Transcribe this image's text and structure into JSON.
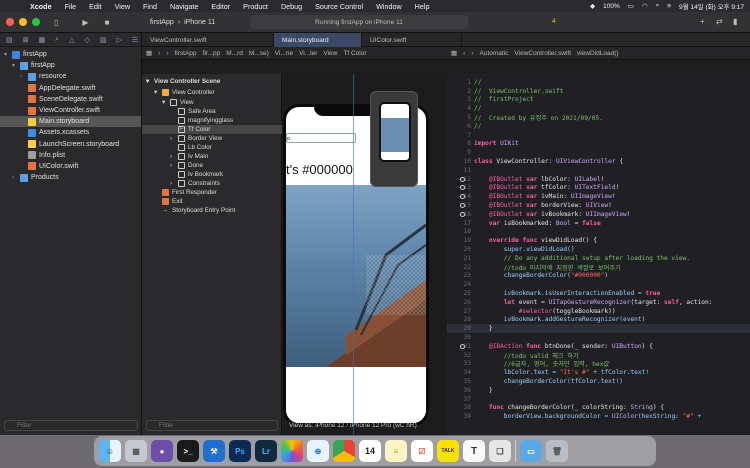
{
  "menubar": {
    "app_name": "Xcode",
    "items": [
      "File",
      "Edit",
      "View",
      "Find",
      "Navigate",
      "Editor",
      "Product",
      "Debug",
      "Source Control",
      "Window",
      "Help"
    ],
    "battery": "100%",
    "datetime": "9월 14일 (화) 오후 9:17"
  },
  "toolbar": {
    "scheme_name": "firstApp",
    "device_name": "iPhone 11",
    "status": "Running firstApp on iPhone 11",
    "warning_count": "4"
  },
  "tabs": [
    {
      "label": "ViewController.swift",
      "active": false
    },
    {
      "label": "Main.storyboard",
      "active": true
    },
    {
      "label": "UIColor.swift",
      "active": false
    }
  ],
  "navigator": {
    "project": "firstApp",
    "items": [
      {
        "label": "firstApp",
        "kind": "folder",
        "depth": 1
      },
      {
        "label": "resource",
        "kind": "folder",
        "depth": 2
      },
      {
        "label": "AppDelegate.swift",
        "kind": "swift",
        "depth": 2
      },
      {
        "label": "SceneDelegate.swift",
        "kind": "swift",
        "depth": 2
      },
      {
        "label": "ViewController.swift",
        "kind": "swift",
        "depth": 2
      },
      {
        "label": "Main.storyboard",
        "kind": "storyboard",
        "depth": 2,
        "selected": true
      },
      {
        "label": "Assets.xcassets",
        "kind": "assets",
        "depth": 2
      },
      {
        "label": "LaunchScreen.storyboard",
        "kind": "storyboard",
        "depth": 2
      },
      {
        "label": "Info.plist",
        "kind": "plist",
        "depth": 2
      },
      {
        "label": "UIColor.swift",
        "kind": "swift",
        "depth": 2
      },
      {
        "label": "Products",
        "kind": "folder",
        "depth": 1
      }
    ],
    "filter_placeholder": "Filter"
  },
  "storyboard_path": [
    "firstApp",
    "fir...pp",
    "M...rd",
    "M...se)",
    "Vi...ne",
    "Vi...ler",
    "View",
    "Tf Color"
  ],
  "code_path": [
    "Automatic",
    "ViewController.swift",
    "viewDidLoad()"
  ],
  "outline": {
    "rows": [
      {
        "label": "View Controller Scene",
        "bold": true
      },
      {
        "label": "View Controller"
      },
      {
        "label": "View"
      },
      {
        "label": "Safe Area"
      },
      {
        "label": "magnifyingglass"
      },
      {
        "label": "Tf Color",
        "selected": true
      },
      {
        "label": "Border View"
      },
      {
        "label": "Lb Color"
      },
      {
        "label": "Iv Main"
      },
      {
        "label": "Done"
      },
      {
        "label": "Iv Bookmark"
      },
      {
        "label": "Constraints"
      },
      {
        "label": "First Responder"
      },
      {
        "label": "Exit"
      },
      {
        "label": "Storyboard Entry Point"
      }
    ],
    "filter_placeholder": "Filter"
  },
  "canvas": {
    "label_text": "t's #000000",
    "view_as": "View as: iPhone 12 / iPhone 12 Pro (wC hR)"
  },
  "code": {
    "start_line": 1,
    "highlight_line": 29,
    "lines": [
      {
        "n": "1",
        "t": "//",
        "c": "comment"
      },
      {
        "n": "2",
        "t": "//  ViewController.swift",
        "c": "comment"
      },
      {
        "n": "3",
        "t": "//  firstProject",
        "c": "comment"
      },
      {
        "n": "4",
        "t": "//",
        "c": "comment"
      },
      {
        "n": "5",
        "t": "//  Created by 유정주 on 2021/09/05.",
        "c": "comment"
      },
      {
        "n": "6",
        "t": "//",
        "c": "comment"
      },
      {
        "n": "7",
        "t": "",
        "c": "plain"
      },
      {
        "n": "8",
        "t": "import UIKit",
        "c": "kw"
      },
      {
        "n": "9",
        "t": "",
        "c": "plain"
      },
      {
        "n": "10",
        "t": "class ViewController: UIViewController {",
        "c": "kw"
      },
      {
        "n": "11",
        "t": "",
        "c": "plain"
      },
      {
        "n": "12",
        "t": "    @IBOutlet var lbColor: UILabel!",
        "c": "outlet",
        "marker": true
      },
      {
        "n": "13",
        "t": "    @IBOutlet var tfColor: UITextField!",
        "c": "outlet",
        "marker": true
      },
      {
        "n": "14",
        "t": "    @IBOutlet var ivMain: UIImageView!",
        "c": "outlet",
        "marker": true
      },
      {
        "n": "15",
        "t": "    @IBOutlet var borderView: UIView!",
        "c": "outlet",
        "marker": true
      },
      {
        "n": "16",
        "t": "    @IBOutlet var ivBookmark: UIImageView!",
        "c": "outlet",
        "marker": true
      },
      {
        "n": "17",
        "t": "    var isBookmarked: Bool = false",
        "c": "kw"
      },
      {
        "n": "18",
        "t": "",
        "c": "plain"
      },
      {
        "n": "19",
        "t": "    override func viewDidLoad() {",
        "c": "kw"
      },
      {
        "n": "20",
        "t": "        super.viewDidLoad()",
        "c": "call"
      },
      {
        "n": "21",
        "t": "        // Do any additional setup after loading the view.",
        "c": "comment"
      },
      {
        "n": "22",
        "t": "        //todo 마지막에 지정한 색깔로 보여주기",
        "c": "comment"
      },
      {
        "n": "23",
        "t": "        changeBorderColor(\"#000000\")",
        "c": "call"
      },
      {
        "n": "24",
        "t": "",
        "c": "plain"
      },
      {
        "n": "25",
        "t": "        ivBookmark.isUserInteractionEnabled = true",
        "c": "call"
      },
      {
        "n": "26",
        "t": "        let event = UITapGestureRecognizer(target: self, action:",
        "c": "kw"
      },
      {
        "n": "27",
        "t": "            #selector(toggleBookmark))",
        "c": "kw"
      },
      {
        "n": "28",
        "t": "        ivBookmark.addGestureRecognizer(event)",
        "c": "call"
      },
      {
        "n": "29",
        "t": "    }",
        "c": "plain"
      },
      {
        "n": "30",
        "t": "",
        "c": "plain"
      },
      {
        "n": "31",
        "t": "    @IBAction func btnDone(_ sender: UIButton) {",
        "c": "outlet",
        "marker": true
      },
      {
        "n": "32",
        "t": "        //todo valid 체크 하기",
        "c": "comment"
      },
      {
        "n": "33",
        "t": "        //6글자, 영어, 숫자만 입력, hex값",
        "c": "comment"
      },
      {
        "n": "34",
        "t": "        lbColor.text = \"It's #\" + tfColor.text!",
        "c": "call"
      },
      {
        "n": "35",
        "t": "        changeBorderColor(tfColor.text!)",
        "c": "call"
      },
      {
        "n": "36",
        "t": "    }",
        "c": "plain"
      },
      {
        "n": "37",
        "t": "",
        "c": "plain"
      },
      {
        "n": "38",
        "t": "    func changeBorderColor(_ colorString: String) {",
        "c": "kw"
      },
      {
        "n": "39",
        "t": "        borderView.backgroundColor = UIColor(hexString: \"#\" +",
        "c": "call"
      }
    ]
  },
  "dock": {
    "apps": [
      "Finder",
      "Launchpad",
      "GitHub",
      "Terminal",
      "Xcode",
      "Photoshop",
      "Lightroom",
      "Photos",
      "Safari",
      "Chrome",
      "Calendar",
      "Notes",
      "Reminders",
      "KakaoTalk",
      "TextEdit",
      "Downloads",
      "Trash"
    ],
    "calendar_day": "14",
    "kakao_label": "TALK"
  },
  "colors": {
    "menubar": "#2b2a2e",
    "editor_bg": "#1f1f24",
    "keyword": "#fc5fa3",
    "comment": "#7ec16e",
    "type": "#d0a8ff",
    "string": "#fc6a5d",
    "accent": "#3a4a66"
  }
}
